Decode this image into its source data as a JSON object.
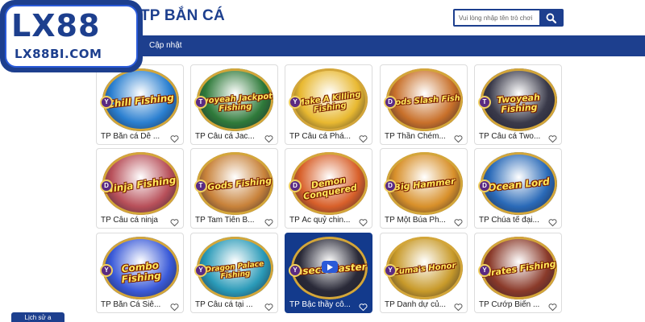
{
  "header": {
    "title": "TP BẮN CÁ",
    "search_placeholder": "Vui lòng nhập tên trò chơi"
  },
  "nav": {
    "update_label": "Cập nhật"
  },
  "logo": {
    "main": "LX88",
    "sub": "LX88BI.COM"
  },
  "footer": {
    "history_label": "Lịch sử a"
  },
  "colors": {
    "brand_blue": "#1d3f8e",
    "active_card": "#133a8c",
    "logo_accent": "#2a5ad8"
  },
  "games": [
    {
      "title": "TP Bắn cá Dễ ...",
      "art": "Chill Fishing",
      "badge": "Y",
      "theme": "#2a7fd0"
    },
    {
      "title": "TP Câu cá Jac...",
      "art": "Twoyeah Jackpot Fishing",
      "badge": "T",
      "theme": "#2f7a3a"
    },
    {
      "title": "TP Câu cá Phá...",
      "art": "Make A Killing Fishing",
      "badge": "Y",
      "theme": "#e8b830"
    },
    {
      "title": "TP Thần Chém...",
      "art": "Gods Slash Fish",
      "badge": "D",
      "theme": "#c8702a"
    },
    {
      "title": "TP Câu cá Two...",
      "art": "Twoyeah Fishing",
      "badge": "T",
      "theme": "#3a3a4a"
    },
    {
      "title": "TP Câu cá ninja",
      "art": "Ninja Fishing",
      "badge": "D",
      "theme": "#b8505a"
    },
    {
      "title": "TP Tam Tiên B...",
      "art": "3 Gods Fishing",
      "badge": "T",
      "theme": "#c8823a"
    },
    {
      "title": "TP Ác quỷ chin...",
      "art": "Demon Conquered",
      "badge": "D",
      "theme": "#d8602a"
    },
    {
      "title": "TP Một Búa Ph...",
      "art": "Big Hammer",
      "badge": "D",
      "theme": "#d8902a"
    },
    {
      "title": "TP Chúa tể đại...",
      "art": "Ocean Lord",
      "badge": "D",
      "theme": "#2a6ab8"
    },
    {
      "title": "TP Bắn Cá Siê...",
      "art": "Combo Fishing",
      "badge": "Y",
      "theme": "#3a5ad8"
    },
    {
      "title": "TP Câu cá tại ...",
      "art": "Dragon Palace Fishing",
      "badge": "Y",
      "theme": "#2a9ab8"
    },
    {
      "title": "TP Bậc thầy cô...",
      "art": "Insect Master",
      "badge": "Y",
      "theme": "#2a2a38",
      "active": true
    },
    {
      "title": "TP Danh dự củ...",
      "art": "Zuma's Honor",
      "badge": "Y",
      "theme": "#c89a2a"
    },
    {
      "title": "TP Cướp Biển ...",
      "art": "Pirates Fishing",
      "badge": "Y",
      "theme": "#8a3a2a"
    }
  ]
}
